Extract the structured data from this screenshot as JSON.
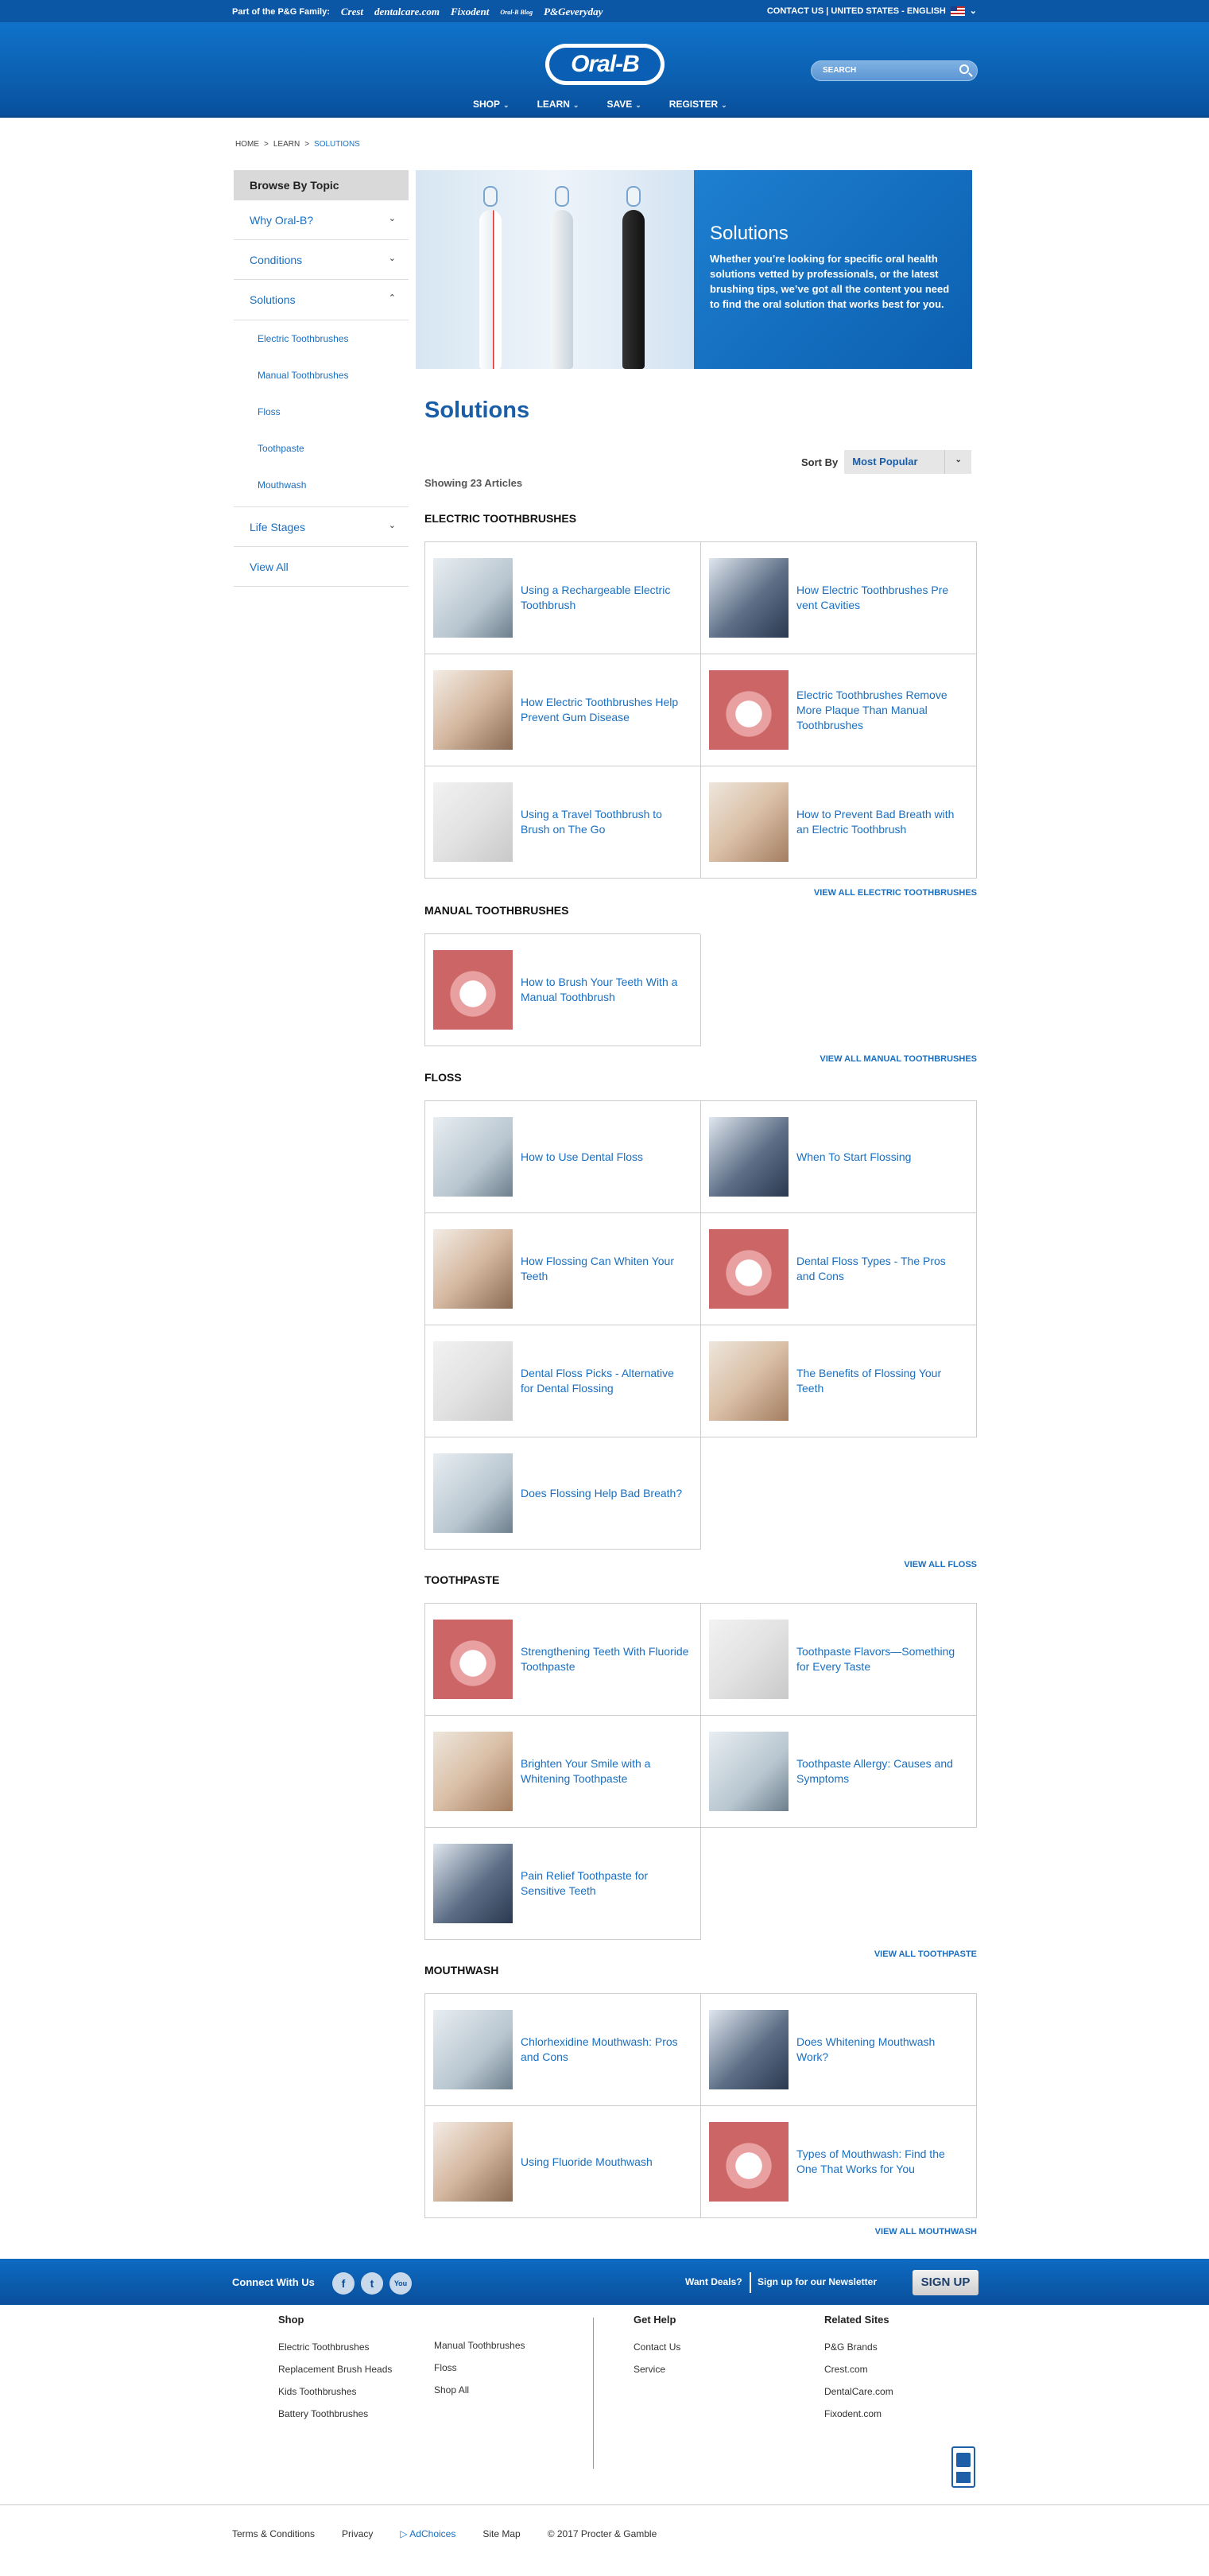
{
  "topbar": {
    "family_label": "Part of the P&G Family:",
    "brands": [
      "Crest",
      "dentalcare.com",
      "Fixodent",
      "Oral-B Blog",
      "P&Geveryday"
    ],
    "right_text": "CONTACT US | UNITED STATES - ENGLISH"
  },
  "header": {
    "logo": "Oral-B",
    "search_placeholder": "SEARCH",
    "nav": [
      "SHOP",
      "LEARN",
      "SAVE",
      "REGISTER"
    ]
  },
  "breadcrumb": [
    "HOME",
    ">",
    "LEARN",
    ">",
    "SOLUTIONS"
  ],
  "sidebar": {
    "title": "Browse By Topic",
    "items": [
      {
        "label": "Why Oral-B?",
        "arrow": "⌄"
      },
      {
        "label": "Conditions",
        "arrow": "⌄"
      },
      {
        "label": "Solutions",
        "arrow": "⌃"
      }
    ],
    "subitems": [
      "Electric Toothbrushes",
      "Manual Toothbrushes",
      "Floss",
      "Toothpaste",
      "Mouthwash"
    ],
    "after": [
      {
        "label": "Life Stages",
        "arrow": "⌄"
      },
      {
        "label": "View All",
        "arrow": ""
      }
    ]
  },
  "hero": {
    "title": "Solutions",
    "text": "Whether you’re looking for specific oral health solutions vetted by professionals, or the latest brushing tips, we’ve got all the content you need to find the oral solution that works best for you."
  },
  "main": {
    "title": "Solutions",
    "sort_label": "Sort By",
    "sort_value": "Most Popular",
    "showing": "Showing 23 Articles"
  },
  "sections": [
    {
      "title": "ELECTRIC TOOTHBRUSHES",
      "view_all": "VIEW ALL ELECTRIC TOOTHBRUSHES",
      "articles": [
        "Using a Rechargeable Electric Toothbrush",
        "How Electric Toothbrushes Pre vent Cavities",
        "How Electric Toothbrushes Help Prevent Gum Disease",
        "Electric Toothbrushes Remove More Plaque Than Manual Toothbrushes",
        "Using a Travel Toothbrush to Brush on The Go",
        "How to Prevent Bad Breath with an Electric Toothbrush"
      ]
    },
    {
      "title": "MANUAL TOOTHBRUSHES",
      "view_all": "VIEW ALL MANUAL TOOTHBRUSHES",
      "articles": [
        "How to Brush Your Teeth With a Manual Toothbrush"
      ]
    },
    {
      "title": "FLOSS",
      "view_all": "VIEW ALL FLOSS",
      "articles": [
        "How to Use Dental Floss",
        "When To Start Flossing",
        "How Flossing Can Whiten Your Teeth",
        "Dental Floss Types - The Pros and Cons",
        "Dental Floss Picks - Alternative for Dental Flossing",
        "The Benefits of Flossing Your Teeth",
        "Does Flossing Help Bad Breath?"
      ]
    },
    {
      "title": "TOOTHPASTE",
      "view_all": "VIEW ALL TOOTHPASTE",
      "articles": [
        "Strengthening Teeth With Fluoride Toothpaste",
        "Toothpaste Flavors—Something for Every Taste",
        "Brighten Your Smile with a Whitening Toothpaste",
        "Toothpaste Allergy: Causes and Symptoms",
        "Pain Relief Toothpaste for Sensitive Teeth"
      ]
    },
    {
      "title": "MOUTHWASH",
      "view_all": "VIEW ALL MOUTHWASH",
      "articles": [
        "Chlorhexidine Mouthwash: Pros and Cons",
        "Does Whitening Mouthwash Work?",
        "Using Fluoride Mouthwash",
        "Types of Mouthwash: Find the One That Works for You"
      ]
    }
  ],
  "footer": {
    "connect": "Connect With Us",
    "social": [
      "f",
      "t",
      "You"
    ],
    "deals": "Want Deals?",
    "newsletter": "Sign up for our Newsletter",
    "signup": "SIGN UP",
    "shop_title": "Shop",
    "shop_col1": [
      "Electric Toothbrushes",
      "Replacement Brush Heads",
      "Kids Toothbrushes",
      "Battery Toothbrushes"
    ],
    "shop_col2": [
      "Manual Toothbrushes",
      "Floss",
      "Shop All"
    ],
    "help_title": "Get Help",
    "help": [
      "Contact Us",
      "Service"
    ],
    "related_title": "Related Sites",
    "related": [
      "P&G Brands",
      "Crest.com",
      "DentalCare.com",
      "Fixodent.com"
    ],
    "legal": [
      "Terms & Conditions",
      "Privacy",
      "AdChoices",
      "Site Map",
      "© 2017 Procter & Gamble"
    ]
  },
  "colors": {
    "primary": "#0c5fb0",
    "link": "#1a6fc0"
  }
}
